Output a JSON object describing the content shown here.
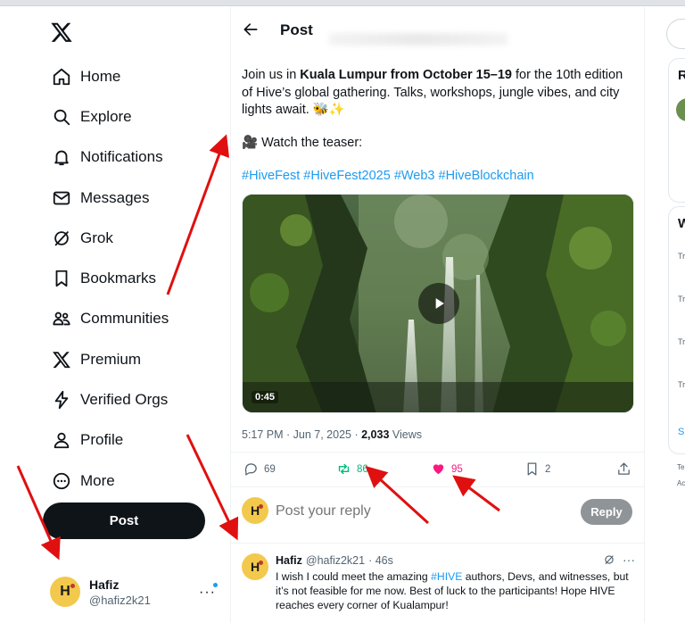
{
  "colors": {
    "accent": "#1d9bf0",
    "text": "#0f1419",
    "muted": "#536471",
    "repost": "#00ba7c",
    "like": "#f91880",
    "annotation": "#e01010"
  },
  "sidebar": {
    "logo_icon": "x-logo-icon",
    "items": [
      {
        "label": "Home",
        "icon": "home-icon"
      },
      {
        "label": "Explore",
        "icon": "search-icon"
      },
      {
        "label": "Notifications",
        "icon": "bell-icon"
      },
      {
        "label": "Messages",
        "icon": "envelope-icon"
      },
      {
        "label": "Grok",
        "icon": "grok-icon"
      },
      {
        "label": "Bookmarks",
        "icon": "bookmark-icon"
      },
      {
        "label": "Communities",
        "icon": "people-icon"
      },
      {
        "label": "Premium",
        "icon": "x-logo-icon"
      },
      {
        "label": "Verified Orgs",
        "icon": "lightning-icon"
      },
      {
        "label": "Profile",
        "icon": "person-icon"
      },
      {
        "label": "More",
        "icon": "more-circle-icon"
      }
    ],
    "post_button": "Post",
    "account": {
      "name": "Hafiz",
      "handle": "@hafiz2k21",
      "more": "···"
    }
  },
  "main": {
    "header_title": "Post",
    "tweet": {
      "text_1": "Join us in ",
      "text_bold_1": "Kuala Lumpur from October 15–19",
      "text_2": " for the 10th edition of Hive’s global gathering. Talks, workshops, jungle vibes, and city lights await. 🐝✨",
      "teaser": "🎥 Watch the teaser:",
      "hashtags": [
        "#HiveFest",
        "#HiveFest2025",
        "#Web3",
        "#HiveBlockchain"
      ],
      "video_duration": "0:45",
      "time": "5:17 PM · Jun 7, 2025 · ",
      "views_count": "2,033",
      "views_label": " Views"
    },
    "actions": {
      "replies": "69",
      "reposts": "86",
      "likes": "95",
      "bookmarks": "2"
    },
    "reply_box": {
      "placeholder": "Post your reply",
      "button": "Reply"
    },
    "reply": {
      "name": "Hafiz",
      "handle": "@hafiz2k21",
      "time": "· 46s",
      "text_1": "I wish I could meet the amazing ",
      "tag": "#HIVE",
      "text_2": " authors, Devs, and witnesses, but it’s not feasible for me now. Best of luck to the participants! Hope HIVE reaches every corner of Kualampur!"
    }
  },
  "right": {
    "card1_letter": "R",
    "card2_letter": "W",
    "trend_prefix": "Tr",
    "show_prefix": "S",
    "footer_1": "Te",
    "footer_2": "Ac"
  }
}
